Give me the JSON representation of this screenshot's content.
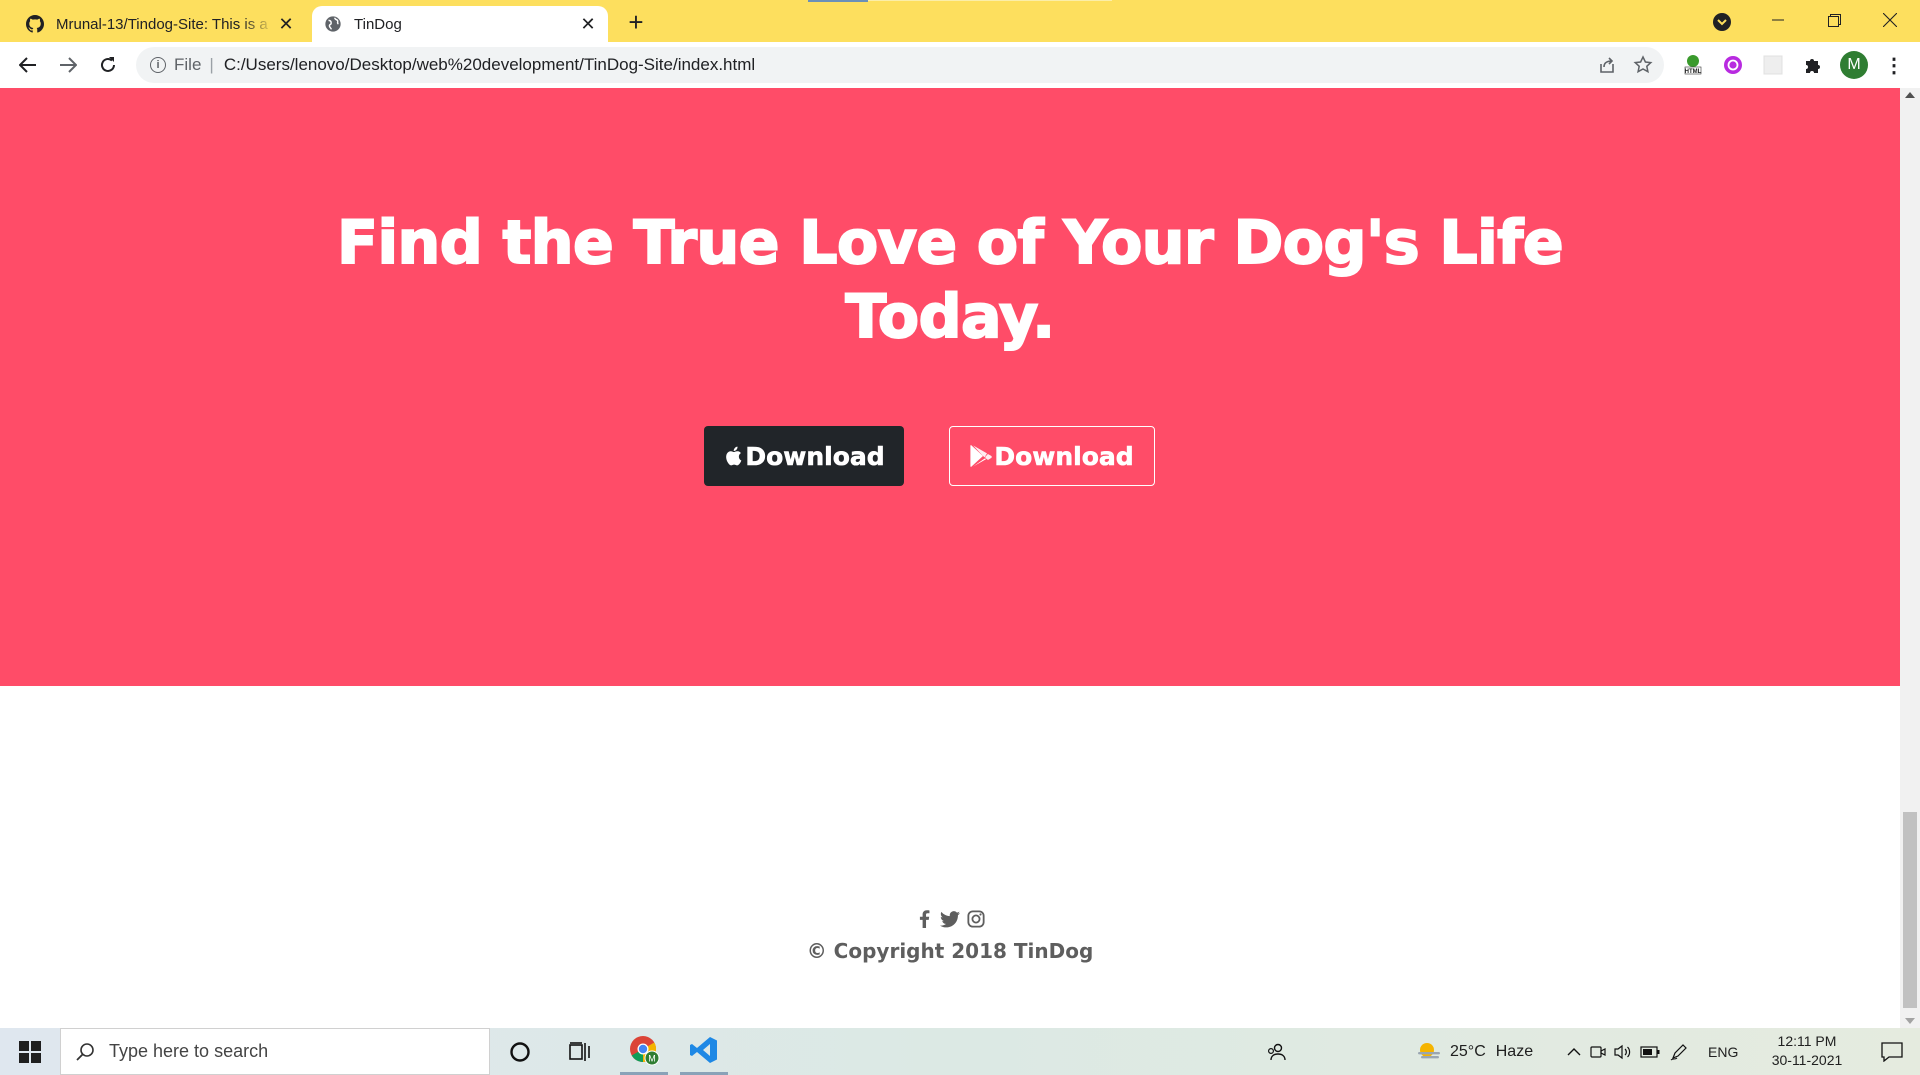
{
  "browser": {
    "tabs": [
      {
        "title": "Mrunal-13/Tindog-Site: This is a",
        "active": false,
        "icon": "github-icon"
      },
      {
        "title": "TinDog",
        "active": true,
        "icon": "globe-icon"
      }
    ],
    "new_tab_label": "+",
    "address": {
      "scheme_label": "File",
      "url": "C:/Users/lenovo/Desktop/web%20development/TinDog-Site/index.html"
    },
    "profile_initial": "M"
  },
  "page": {
    "cta": {
      "heading": "Find the True Love of Your Dog's Life Today.",
      "apple_button_label": "Download",
      "play_button_label": "Download",
      "background_color": "#ff4c68"
    },
    "footer": {
      "social_icons": [
        "facebook-icon",
        "twitter-icon",
        "instagram-icon"
      ],
      "copyright": "© Copyright 2018 TinDog"
    }
  },
  "taskbar": {
    "search_placeholder": "Type here to search",
    "weather": {
      "temp": "25°C",
      "condition": "Haze"
    },
    "language": "ENG",
    "time": "12:11 PM",
    "date": "30-11-2021"
  }
}
